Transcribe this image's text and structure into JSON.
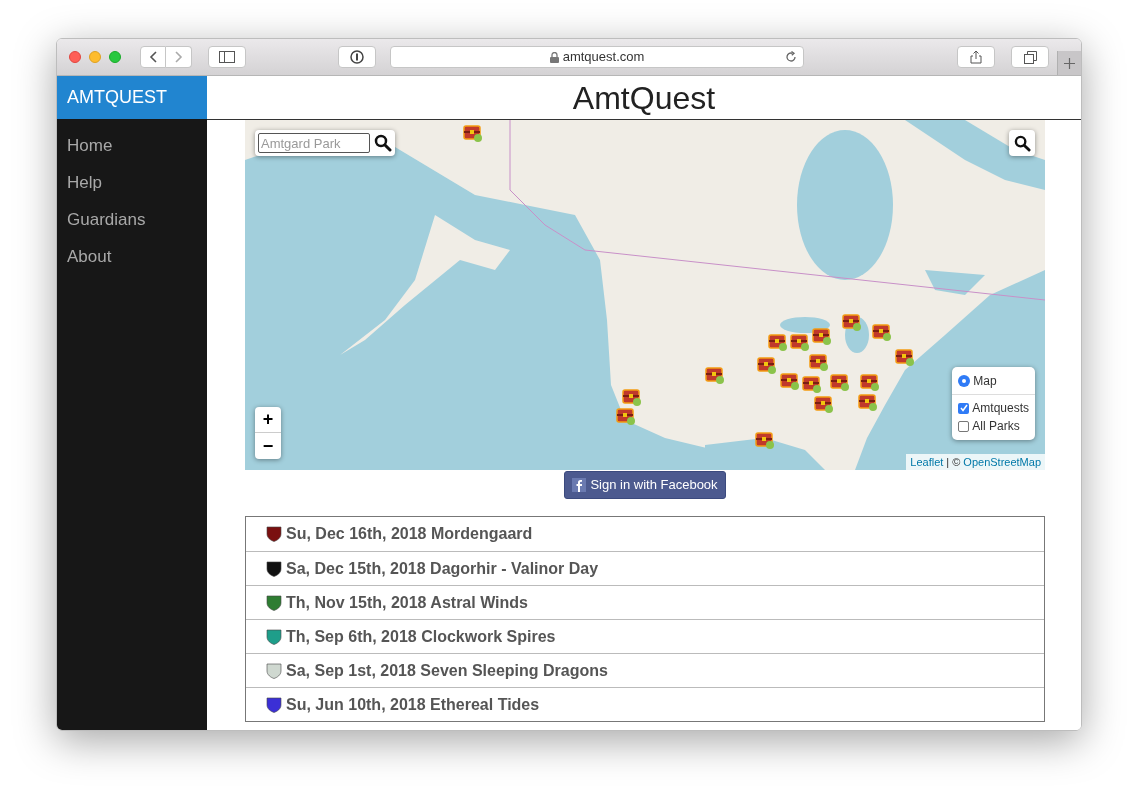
{
  "browser": {
    "url": "amtquest.com"
  },
  "sidebar": {
    "brand": "AMTQUEST",
    "items": [
      {
        "label": "Home"
      },
      {
        "label": "Help"
      },
      {
        "label": "Guardians"
      },
      {
        "label": "About"
      }
    ]
  },
  "header": {
    "title": "AmtQuest"
  },
  "map": {
    "search": {
      "placeholder": "Amtgard Park"
    },
    "zoom": {
      "in": "+",
      "out": "−"
    },
    "base_layers": [
      {
        "label": "Map",
        "selected": true
      }
    ],
    "overlays": [
      {
        "label": "Amtquests",
        "checked": true
      },
      {
        "label": "All Parks",
        "checked": false
      }
    ],
    "attribution": {
      "link_1": "Leaflet",
      "separator": "| ©",
      "link_2": "OpenStreetMap"
    }
  },
  "facebook_button": {
    "label": "Sign in with Facebook"
  },
  "events": [
    {
      "text": "Su, Dec 16th, 2018 Mordengaard",
      "color": "#7a1010"
    },
    {
      "text": "Sa, Dec 15th, 2018 Dagorhir - Valinor Day",
      "color": "#111111"
    },
    {
      "text": "Th, Nov 15th, 2018 Astral Winds",
      "color": "#2e7d32"
    },
    {
      "text": "Th, Sep 6th, 2018 Clockwork Spires",
      "color": "#1e9e8a"
    },
    {
      "text": "Sa, Sep 1st, 2018 Seven Sleeping Dragons",
      "color": "#cfd8d0"
    },
    {
      "text": "Su, Jun 10th, 2018 Ethereal Tides",
      "color": "#3b2fd6"
    }
  ]
}
